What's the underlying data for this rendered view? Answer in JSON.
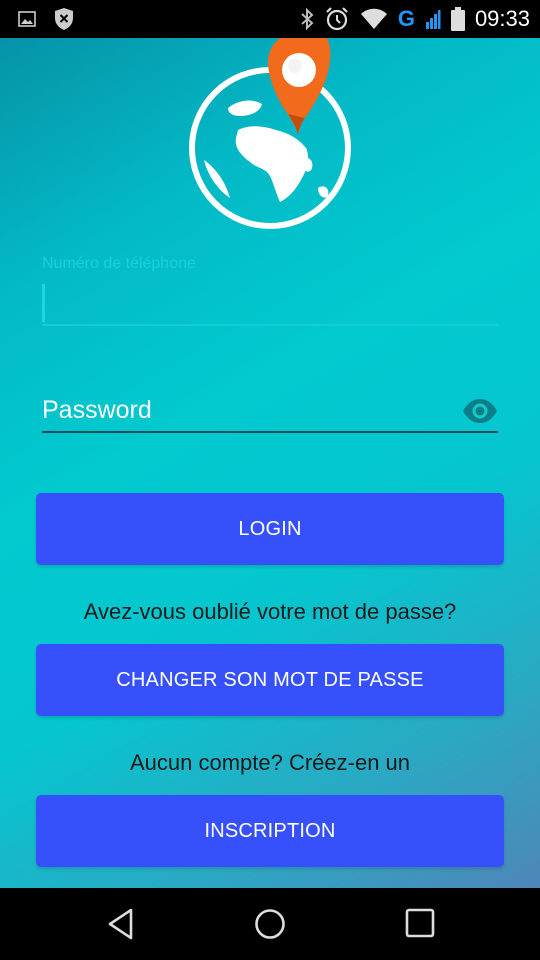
{
  "status_bar": {
    "time": "09:33",
    "network_type": "G",
    "icons": [
      "image-notification-icon",
      "shield-notification-icon",
      "bluetooth-icon",
      "alarm-icon",
      "wifi-icon",
      "signal-icon",
      "battery-icon"
    ]
  },
  "colors": {
    "background_top": "#0693a8",
    "background_mid": "#02cacf",
    "background_bottom": "#4e86b9",
    "button": "#3651fb",
    "accent": "#14d3d8",
    "pin": "#f26a1b"
  },
  "form": {
    "phone_label": "Numéro de téléphone",
    "phone_value": "",
    "password_placeholder": "Password",
    "password_value": "",
    "visibility_icon": "eye-icon"
  },
  "buttons": {
    "login": "LOGIN",
    "change_password": "CHANGER SON MOT DE PASSE",
    "signup": "INSCRIPTION"
  },
  "prompts": {
    "forgot": "Avez-vous oublié votre mot de passe?",
    "no_account": "Aucun compte? Créez-en un"
  },
  "nav_bar": {
    "icons": [
      "back-icon",
      "home-icon",
      "recents-icon"
    ]
  }
}
